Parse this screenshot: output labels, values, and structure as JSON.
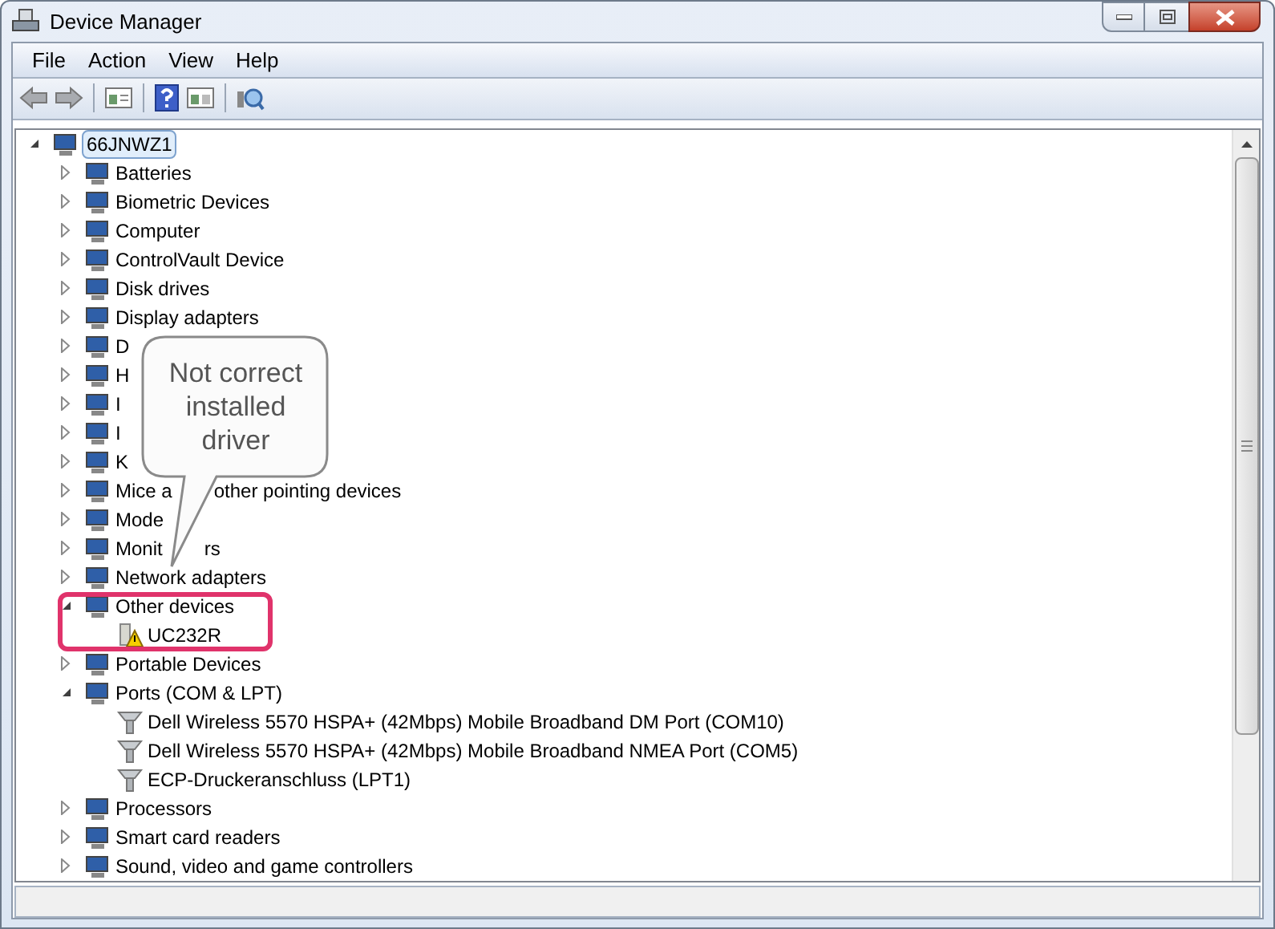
{
  "window": {
    "title": "Device Manager"
  },
  "menu": [
    "File",
    "Action",
    "View",
    "Help"
  ],
  "tree": {
    "label": "66JNWZ1",
    "selected": true,
    "expanded": true,
    "children": [
      {
        "label": "Batteries",
        "selected": false,
        "expanded": false
      },
      {
        "label": "Biometric Devices",
        "selected": false,
        "expanded": false
      },
      {
        "label": "Computer",
        "selected": false,
        "expanded": false
      },
      {
        "label": "ControlVault Device",
        "selected": false,
        "expanded": false
      },
      {
        "label": "Disk drives",
        "selected": false,
        "expanded": false
      },
      {
        "label": "Display adapters",
        "selected": false,
        "expanded": false
      },
      {
        "label": "D",
        "selected": false,
        "expanded": false
      },
      {
        "label": "H",
        "selected": false,
        "expanded": false
      },
      {
        "label": "I",
        "selected": false,
        "expanded": false
      },
      {
        "label": "I",
        "selected": false,
        "expanded": false
      },
      {
        "label": "K",
        "selected": false,
        "expanded": false
      },
      {
        "label": "Mice a",
        "label_rest": "other pointing devices",
        "selected": false,
        "expanded": false
      },
      {
        "label": "Mode",
        "selected": false,
        "expanded": false
      },
      {
        "label": "Monit",
        "label_rest": "rs",
        "selected": false,
        "expanded": false
      },
      {
        "label": "Network adapters",
        "selected": false,
        "expanded": false
      },
      {
        "label": "Other devices",
        "selected": false,
        "expanded": true,
        "children": [
          {
            "label": "UC232R",
            "selected": false,
            "warning": true
          }
        ]
      },
      {
        "label": "Portable Devices",
        "selected": false,
        "expanded": false
      },
      {
        "label": "Ports (COM & LPT)",
        "selected": false,
        "expanded": true,
        "children": [
          {
            "label": "Dell Wireless 5570 HSPA+ (42Mbps) Mobile Broadband DM Port (COM10)",
            "selected": false,
            "warning": false
          },
          {
            "label": "Dell Wireless 5570 HSPA+ (42Mbps) Mobile Broadband NMEA Port (COM5)",
            "selected": false,
            "warning": false
          },
          {
            "label": "ECP-Druckeranschluss (LPT1)",
            "selected": false,
            "warning": false
          }
        ]
      },
      {
        "label": "Processors",
        "selected": false,
        "expanded": false
      },
      {
        "label": "Smart card readers",
        "selected": false,
        "expanded": false
      },
      {
        "label": "Sound, video and game controllers",
        "selected": false,
        "expanded": false
      }
    ]
  },
  "callout": {
    "text": "Not correct installed driver"
  }
}
